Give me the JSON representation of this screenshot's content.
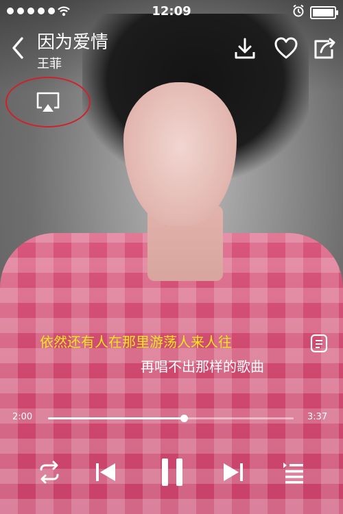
{
  "status_bar": {
    "time": "12:09",
    "signal_icon": "signal-dots-icon",
    "wifi_icon": "wifi-icon",
    "alarm_icon": "alarm-clock-icon",
    "battery_icon": "battery-full-icon"
  },
  "header": {
    "song_title": "因为爱情",
    "artist": "王菲",
    "back_icon": "chevron-left-icon",
    "download_icon": "download-icon",
    "like_icon": "heart-outline-icon",
    "share_icon": "share-icon"
  },
  "airplay": {
    "icon": "airplay-icon",
    "highlight_color": "#d0202a"
  },
  "lyrics": {
    "current_line": "依然还有人在那里游荡人来人往",
    "next_line": "再唱不出那样的歌曲",
    "current_color": "#f0e51a",
    "lyrics_icon": "lyrics-icon"
  },
  "progress": {
    "elapsed": "2:00",
    "total": "3:37",
    "fraction": 0.553
  },
  "controls": {
    "repeat_icon": "repeat-icon",
    "prev_icon": "previous-track-icon",
    "play_icon": "pause-icon",
    "next_icon": "next-track-icon",
    "playlist_icon": "playlist-icon"
  }
}
